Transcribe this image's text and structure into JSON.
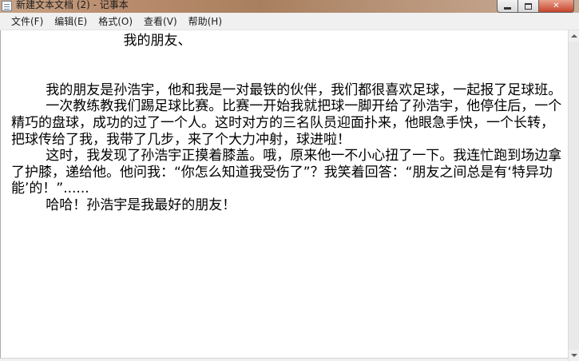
{
  "window": {
    "title": "新建文本文档 (2) - 记事本",
    "close_label": "✕"
  },
  "menu": {
    "items": [
      {
        "label": "文件(F)"
      },
      {
        "label": "编辑(E)"
      },
      {
        "label": "格式(O)"
      },
      {
        "label": "查看(V)"
      },
      {
        "label": "帮助(H)"
      }
    ]
  },
  "document": {
    "text": "                          我的朋友、\n\n\n        我的朋友是孙浩宇，他和我是一对最铁的伙伴，我们都很喜欢足球，一起报了足球班。\n        一次教练教我们踢足球比赛。比赛一开始我就把球一脚开给了孙浩宇，他停住后，一个精巧的盘球，成功的过了一个人。这时对方的三名队员迎面扑来，他眼急手快，一个长转，把球传给了我，我带了几步，来了个大力冲射，球进啦！\n        这时，我发现了孙浩宇正摸着膝盖。哦，原来他一不小心扭了一下。我连忙跑到场边拿了护膝，递给他。他问我：“你怎么知道我受伤了”？我笑着回答：“朋友之间总是有‘特异功能’的！”......\n        哈哈！孙浩宇是我最好的朋友！"
  },
  "icons": {
    "app": "notepad-icon",
    "minimize": "minimize-icon",
    "maximize": "maximize-icon",
    "close": "close-icon"
  }
}
